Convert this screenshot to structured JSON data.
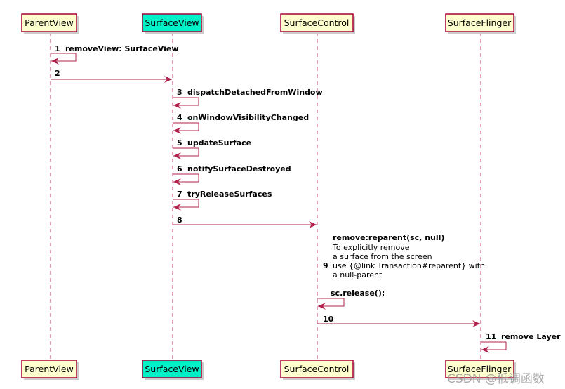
{
  "participants": [
    {
      "name": "ParentView",
      "color": "#FEFECE"
    },
    {
      "name": "SurfaceView",
      "color": "#00F0C8"
    },
    {
      "name": "SurfaceControl",
      "color": "#FEFECE"
    },
    {
      "name": "SurfaceFlinger",
      "color": "#FEFECE"
    }
  ],
  "messages": [
    {
      "num": "1",
      "label": "removeView: SurfaceView"
    },
    {
      "num": "2",
      "label": ""
    },
    {
      "num": "3",
      "label": "dispatchDetachedFromWindow"
    },
    {
      "num": "4",
      "label": "onWindowVisibilityChanged"
    },
    {
      "num": "5",
      "label": "updateSurface"
    },
    {
      "num": "6",
      "label": "notifySurfaceDestroyed"
    },
    {
      "num": "7",
      "label": "tryReleaseSurfaces"
    },
    {
      "num": "8",
      "label": ""
    },
    {
      "num": "9",
      "label": "remove:reparent(sc, null)",
      "lines": [
        "To explicitly remove",
        "a surface from the screen",
        "use {@link Transaction#reparent} with",
        "a null-parent"
      ]
    },
    {
      "num": "",
      "label": "sc.release();"
    },
    {
      "num": "10",
      "label": ""
    },
    {
      "num": "11",
      "label": "remove Layer"
    }
  ],
  "colors": {
    "line": "#A80036",
    "box_border": "#A80036"
  },
  "watermark": "CSDN @低调函数"
}
